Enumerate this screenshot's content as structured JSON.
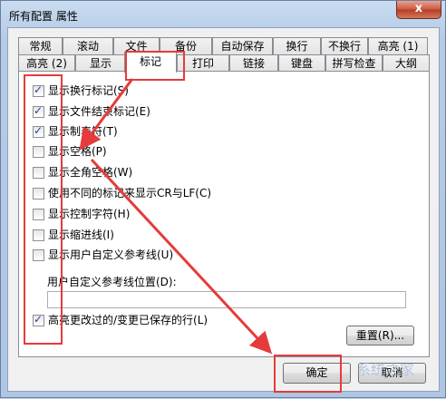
{
  "window": {
    "title": "所有配置 属性",
    "close_label": "x"
  },
  "tabs_back": [
    "常规",
    "滚动",
    "文件",
    "备份",
    "自动保存",
    "换行",
    "不换行",
    "高亮 (1)"
  ],
  "tabs_front": [
    "高亮 (2)",
    "显示",
    "标记",
    "打印",
    "链接",
    "键盘",
    "拼写检查",
    "大纲"
  ],
  "active_tab": "标记",
  "options": [
    {
      "label": "显示换行标记(S)",
      "checked": true
    },
    {
      "label": "显示文件结束标记(E)",
      "checked": true
    },
    {
      "label": "显示制表符(T)",
      "checked": true
    },
    {
      "label": "显示空格(P)",
      "checked": false
    },
    {
      "label": "显示全角空格(W)",
      "checked": false
    },
    {
      "label": "使用不同的标记来显示CR与LF(C)",
      "checked": false
    },
    {
      "label": "显示控制字符(H)",
      "checked": false
    },
    {
      "label": "显示缩进线(I)",
      "checked": false
    },
    {
      "label": "显示用户自定义参考线(U)",
      "checked": false
    }
  ],
  "guide_position": {
    "label": "用户自定义参考线位置(D):",
    "value": ""
  },
  "highlight_option": {
    "label": "高亮更改过的/变更已保存的行(L)",
    "checked": true
  },
  "buttons": {
    "reset": "重置(R)...",
    "ok": "确定",
    "cancel": "取消"
  },
  "watermark": "系统之家",
  "colors": {
    "annotation": "#e53b3b",
    "checkmark": "#21409a"
  }
}
